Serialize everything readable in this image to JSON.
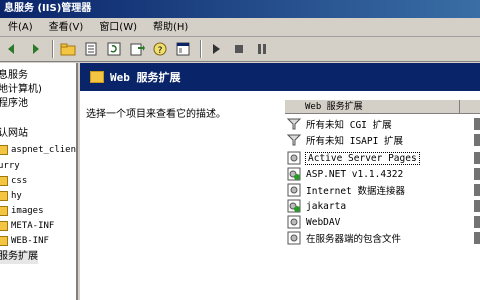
{
  "window": {
    "title": "息服务 (IIS)管理器"
  },
  "menu": [
    {
      "label": "件(A)"
    },
    {
      "label": "查看(V)"
    },
    {
      "label": "窗口(W)"
    },
    {
      "label": "帮助(H)"
    }
  ],
  "toolbar": {
    "buttons": [
      {
        "icon": "back-icon"
      },
      {
        "icon": "forward-icon"
      },
      {
        "icon": "up-folder-icon"
      },
      {
        "icon": "properties-icon"
      },
      {
        "icon": "refresh-icon"
      },
      {
        "icon": "export-icon"
      },
      {
        "icon": "help-icon"
      },
      {
        "icon": "console-icon"
      },
      {
        "icon": "play-icon"
      },
      {
        "icon": "stop-icon"
      },
      {
        "icon": "pause-icon"
      }
    ]
  },
  "tree": {
    "items": [
      {
        "label": "息服务"
      },
      {
        "label": "地计算机)"
      },
      {
        "label": "程序池"
      },
      {
        "label": "认网站"
      },
      {
        "label": "aspnet_clien"
      },
      {
        "label": "urry"
      },
      {
        "label": "css"
      },
      {
        "label": "hy"
      },
      {
        "label": "images"
      },
      {
        "label": "META-INF"
      },
      {
        "label": "WEB-INF"
      },
      {
        "label": "服务扩展"
      }
    ]
  },
  "main": {
    "header_title": "Web 服务扩展",
    "description": "选择一个项目来查看它的描述。",
    "list": {
      "column_header": "Web 服务扩展",
      "items": [
        {
          "label": "所有未知 CGI 扩展",
          "icon": "filter-icon"
        },
        {
          "label": "所有未知 ISAPI 扩展",
          "icon": "filter-icon"
        },
        {
          "label": "Active Server Pages",
          "icon": "extension-icon"
        },
        {
          "label": "ASP.NET v1.1.4322",
          "icon": "extension-allowed-icon"
        },
        {
          "label": "Internet 数据连接器",
          "icon": "extension-icon"
        },
        {
          "label": "jakarta",
          "icon": "extension-allowed-icon"
        },
        {
          "label": "WebDAV",
          "icon": "extension-icon"
        },
        {
          "label": "在服务器端的包含文件",
          "icon": "extension-icon"
        }
      ]
    }
  },
  "colors": {
    "title_bar": "#0a246a",
    "header_band": "#0a246a",
    "background": "#d4d0c8"
  }
}
